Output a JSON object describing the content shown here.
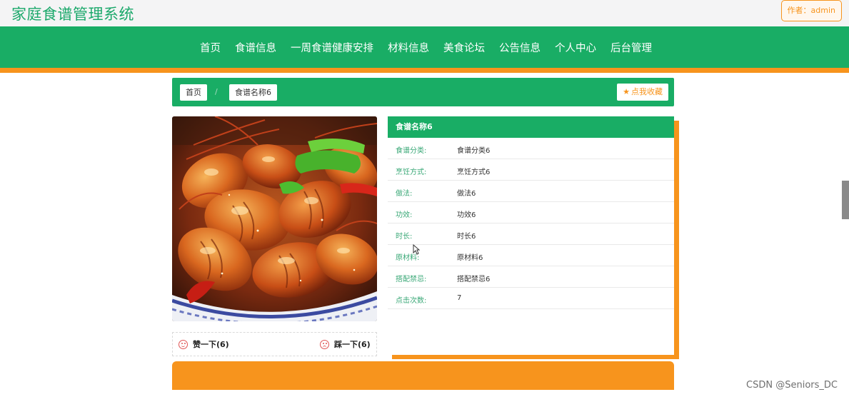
{
  "site": {
    "title": "家庭食谱管理系统",
    "author_badge": "作者：admin"
  },
  "nav": {
    "items": [
      "首页",
      "食谱信息",
      "一周食谱健康安排",
      "材料信息",
      "美食论坛",
      "公告信息",
      "个人中心",
      "后台管理"
    ]
  },
  "breadcrumb": {
    "home": "首页",
    "separator": "/",
    "current": "食谱名称6",
    "favorite_label": "点我收藏"
  },
  "recipe": {
    "name": "食谱名称6",
    "image_icon": "crayfish-dish-photo",
    "fields": [
      {
        "label": "食谱分类:",
        "value": "食谱分类6"
      },
      {
        "label": "烹饪方式:",
        "value": "烹饪方式6"
      },
      {
        "label": "做法:",
        "value": "做法6"
      },
      {
        "label": "功效:",
        "value": "功效6"
      },
      {
        "label": "时长:",
        "value": "时长6"
      },
      {
        "label": "原材料:",
        "value": "原材料6"
      },
      {
        "label": "搭配禁忌:",
        "value": "搭配禁忌6"
      },
      {
        "label": "点击次数:",
        "value": "7"
      }
    ],
    "like_label": "赞一下(6)",
    "dislike_label": "踩一下(6)"
  },
  "watermark": "CSDN @Seniors_DC",
  "colors": {
    "brand_green": "#19ad65",
    "accent_orange": "#f7941d",
    "title_green": "#1aa86a"
  }
}
